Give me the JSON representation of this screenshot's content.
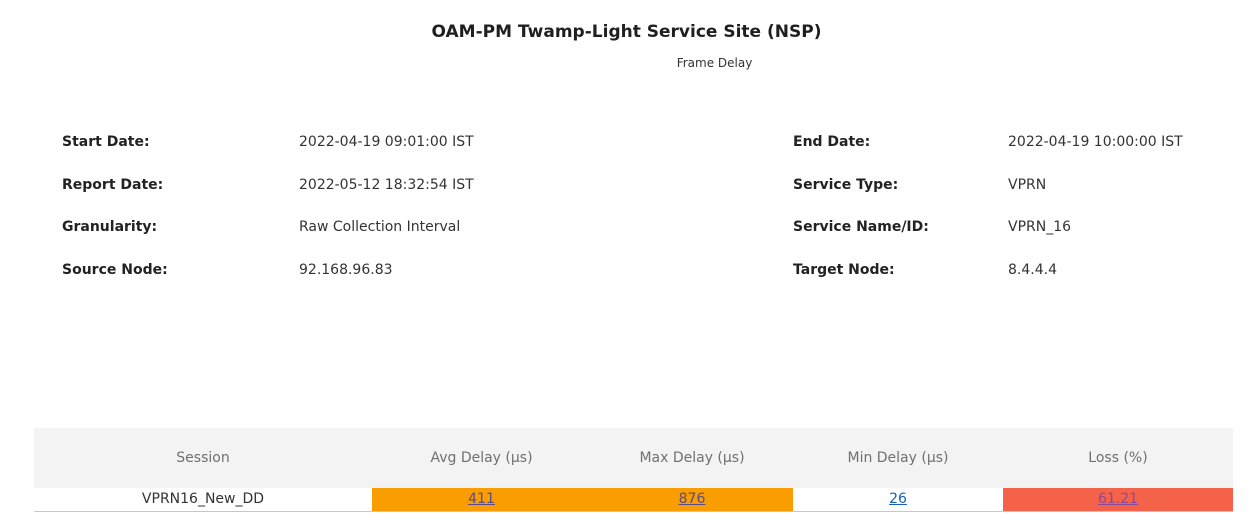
{
  "report": {
    "title": "OAM-PM Twamp-Light Service Site (NSP)",
    "subtitle": "Frame Delay"
  },
  "info": {
    "start_date_label": "Start Date:",
    "start_date_value": "2022-04-19 09:01:00 IST",
    "report_date_label": "Report Date:",
    "report_date_value": "2022-05-12 18:32:54 IST",
    "granularity_label": "Granularity:",
    "granularity_value": "Raw Collection Interval",
    "source_node_label": "Source Node:",
    "source_node_value": "92.168.96.83",
    "end_date_label": "End Date:",
    "end_date_value": "2022-04-19 10:00:00 IST",
    "service_type_label": "Service Type:",
    "service_type_value": "VPRN",
    "service_name_label": "Service Name/ID:",
    "service_name_value": "VPRN_16",
    "target_node_label": "Target Node:",
    "target_node_value": "8.4.4.4"
  },
  "table": {
    "headers": [
      "Session",
      "Avg Delay (µs)",
      "Max Delay (µs)",
      "Min Delay (µs)",
      "Loss (%)"
    ],
    "rows": [
      {
        "session": "VPRN16_New_DD",
        "avg_delay": "411",
        "max_delay": "876",
        "min_delay": "26",
        "loss": "61.21"
      }
    ]
  },
  "colors": {
    "threshold_warning": "#fa9d00",
    "threshold_critical": "#f4624a",
    "link_normal": "#1a5fb4",
    "link_on_warning": "#5a4a8a",
    "link_on_critical": "#8a4a9a",
    "header_bg": "#f3f3f3"
  }
}
